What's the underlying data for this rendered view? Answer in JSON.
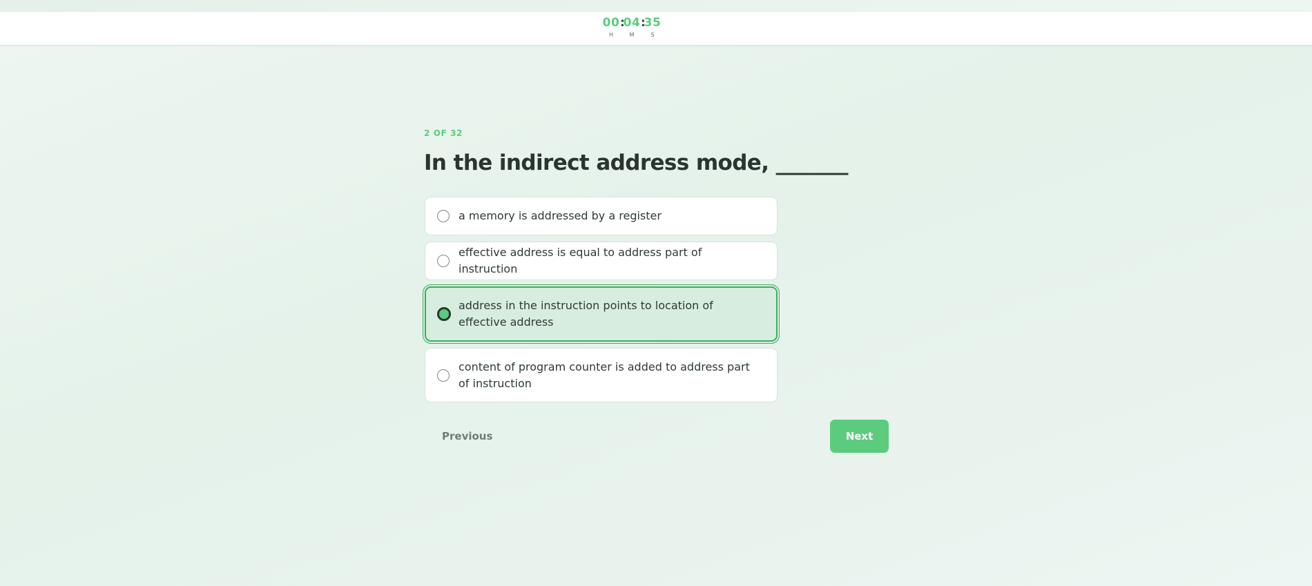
{
  "timer": {
    "hours": "00",
    "minutes": "04",
    "seconds": "35",
    "separator": ":",
    "hours_label": "H",
    "minutes_label": "M",
    "seconds_label": "S"
  },
  "question": {
    "counter": "2 OF 32",
    "text": "In the indirect address mode, _______"
  },
  "options": [
    {
      "label": "a memory is addressed by a register",
      "selected": false
    },
    {
      "label": "effective address is equal to address part of instruction",
      "selected": false
    },
    {
      "label": "address in the instruction points to location of effective address",
      "selected": true
    },
    {
      "label": "content of program counter is added to address part of instruction",
      "selected": false
    }
  ],
  "nav": {
    "previous_label": "Previous",
    "next_label": "Next"
  },
  "colors": {
    "accent": "#5ccb7e",
    "selected_border": "#3fae5e",
    "selected_background": "#d7eddf"
  }
}
